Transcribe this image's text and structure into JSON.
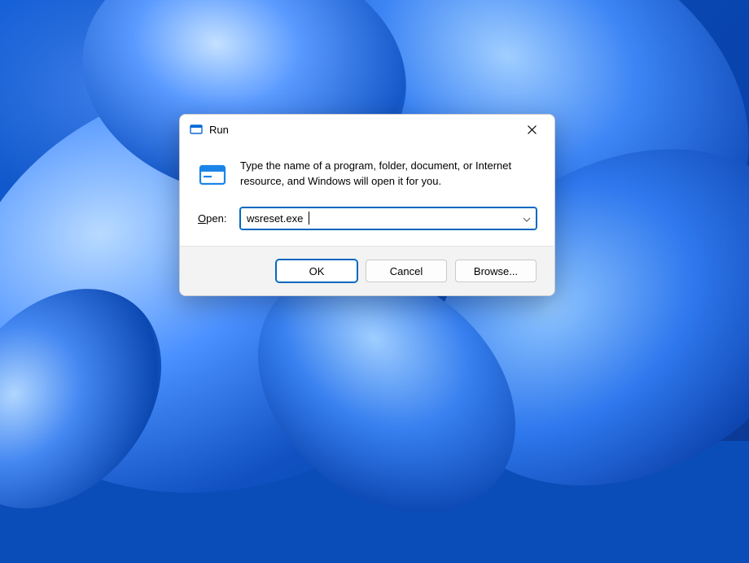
{
  "dialog": {
    "title": "Run",
    "description": "Type the name of a program, folder, document, or Internet resource, and Windows will open it for you.",
    "open_label": "Open:",
    "input_value": "wsreset.exe",
    "buttons": {
      "ok": "OK",
      "cancel": "Cancel",
      "browse": "Browse..."
    }
  },
  "icons": {
    "titlebar": "run-app-icon",
    "main": "run-app-icon",
    "close": "close-icon",
    "chevron": "chevron-down-icon"
  }
}
